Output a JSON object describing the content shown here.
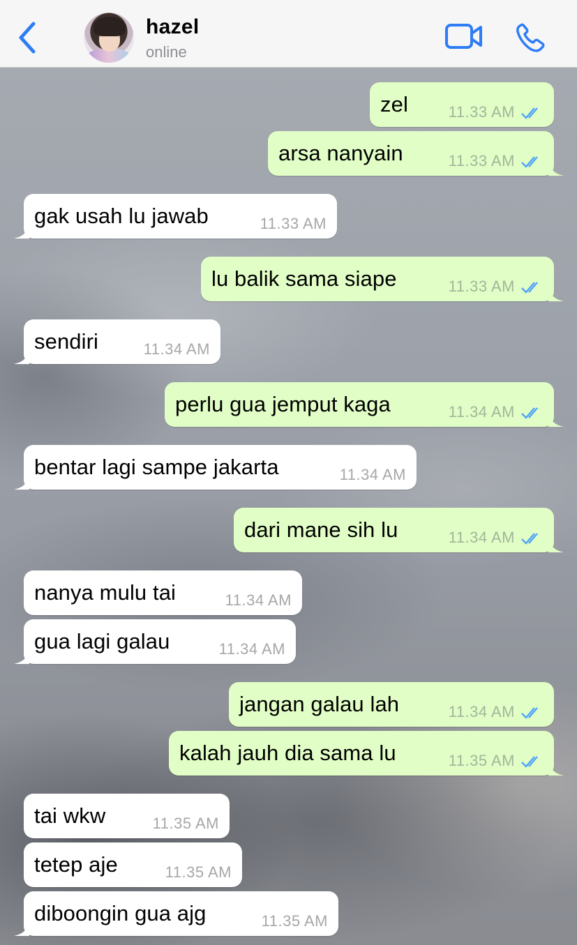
{
  "header": {
    "contact_name": "hazel",
    "status": "online",
    "icons": [
      "back-chevron-icon",
      "video-camera-icon",
      "phone-icon"
    ],
    "accent_color": "#2e7cf6"
  },
  "colors": {
    "outgoing_bubble": "#e1fec6",
    "incoming_bubble": "#ffffff",
    "read_ticks": "#4fa3f7"
  },
  "messages": [
    {
      "direction": "out",
      "text": "zel",
      "time": "11.33 AM",
      "read": true
    },
    {
      "direction": "out",
      "text": "arsa nanyain",
      "time": "11.33 AM",
      "read": true
    },
    {
      "direction": "in",
      "text": "gak usah lu jawab",
      "time": "11.33 AM"
    },
    {
      "direction": "out",
      "text": "lu balik sama siape",
      "time": "11.33 AM",
      "read": true
    },
    {
      "direction": "in",
      "text": "sendiri",
      "time": "11.34 AM"
    },
    {
      "direction": "out",
      "text": "perlu gua jemput kaga",
      "time": "11.34 AM",
      "read": true
    },
    {
      "direction": "in",
      "text": "bentar lagi sampe jakarta",
      "time": "11.34 AM"
    },
    {
      "direction": "out",
      "text": "dari mane sih lu",
      "time": "11.34 AM",
      "read": true
    },
    {
      "direction": "in",
      "text": "nanya mulu tai",
      "time": "11.34 AM"
    },
    {
      "direction": "in",
      "text": "gua lagi galau",
      "time": "11.34 AM"
    },
    {
      "direction": "out",
      "text": "jangan galau lah",
      "time": "11.34 AM",
      "read": true
    },
    {
      "direction": "out",
      "text": "kalah jauh dia sama lu",
      "time": "11.35 AM",
      "read": true
    },
    {
      "direction": "in",
      "text": "tai wkw",
      "time": "11.35 AM"
    },
    {
      "direction": "in",
      "text": "tetep aje",
      "time": "11.35 AM"
    },
    {
      "direction": "in",
      "text": "diboongin gua ajg",
      "time": "11.35 AM"
    }
  ]
}
